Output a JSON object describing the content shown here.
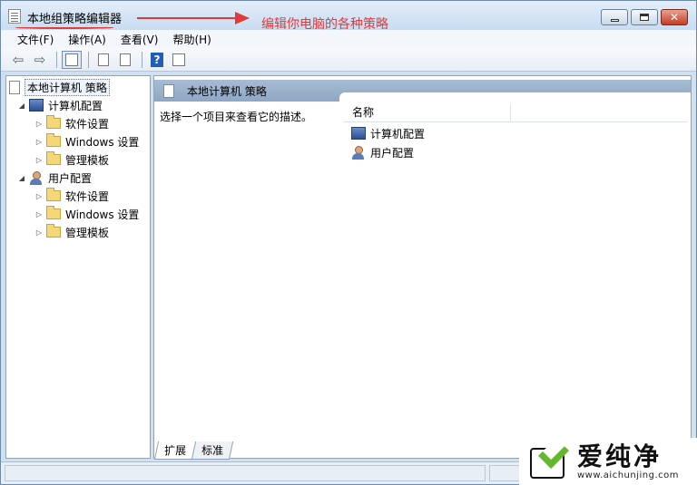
{
  "window": {
    "title": "本地组策略编辑器",
    "annotation": "编辑你电脑的各种策略",
    "close_glyph": "✕"
  },
  "menu": [
    "文件(F)",
    "操作(A)",
    "查看(V)",
    "帮助(H)"
  ],
  "toolbar": {
    "back_glyph": "⇦",
    "forward_glyph": "⇨",
    "help_glyph": "?",
    "icons": [
      "back-icon",
      "forward-icon",
      "show-hide-tree-icon",
      "properties-icon",
      "export-list-icon",
      "help-icon",
      "action-pane-icon"
    ]
  },
  "tree": {
    "root": "本地计算机 策略",
    "computer_config": {
      "label": "计算机配置",
      "children": [
        "软件设置",
        "Windows 设置",
        "管理模板"
      ]
    },
    "user_config": {
      "label": "用户配置",
      "children": [
        "软件设置",
        "Windows 设置",
        "管理模板"
      ]
    },
    "expanded_glyph": "◢",
    "collapsed_glyph": "▷"
  },
  "main": {
    "header_title": "本地计算机 策略",
    "description": "选择一个项目来查看它的描述。",
    "column_name": "名称",
    "items": [
      "计算机配置",
      "用户配置"
    ],
    "tabs": [
      "扩展",
      "标准"
    ]
  },
  "watermark": {
    "title": "爱纯净",
    "url": "www.aichunjing.com"
  },
  "colors": {
    "annotation_red": "#e23a3a",
    "header_blue": "#9fb4cc",
    "watermark_green": "#65b82d"
  }
}
